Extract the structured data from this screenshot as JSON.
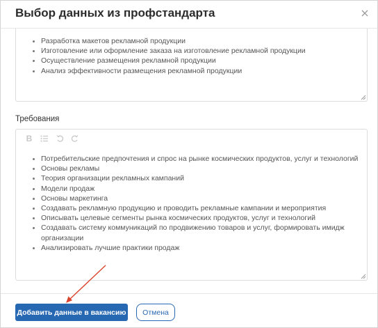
{
  "dialog": {
    "title": "Выбор данных из профстандарта"
  },
  "functions_box": {
    "items": [
      "Разработка макетов рекламной продукции",
      "Изготовление или оформление заказа на изготовление рекламной продукции",
      "Осуществление размещения рекламной продукции",
      "Анализ эффективности размещения рекламной продукции"
    ]
  },
  "requirements": {
    "label": "Требования",
    "toolbar": [
      "bold-icon",
      "list-icon",
      "undo-icon",
      "redo-icon"
    ],
    "items": [
      "Потребительские предпочтения и спрос на рынке космических продуктов, услуг и технологий",
      "Основы рекламы",
      "Теория организации рекламных кампаний",
      "Модели продаж",
      "Основы маркетинга",
      "Создавать рекламную продукцию и проводить рекламные кампании и мероприятия",
      "Описывать целевые сегменты рынка космических продуктов, услуг и технологий",
      "Создавать систему коммуникаций по продвижению товаров и услуг, формировать имидж организации",
      "Анализировать лучшие практики продаж"
    ]
  },
  "footer": {
    "add_label": "Добавить данные в вакансию",
    "cancel_label": "Отмена"
  },
  "colors": {
    "primary": "#2768b3",
    "annotation_arrow": "#d9432f"
  }
}
